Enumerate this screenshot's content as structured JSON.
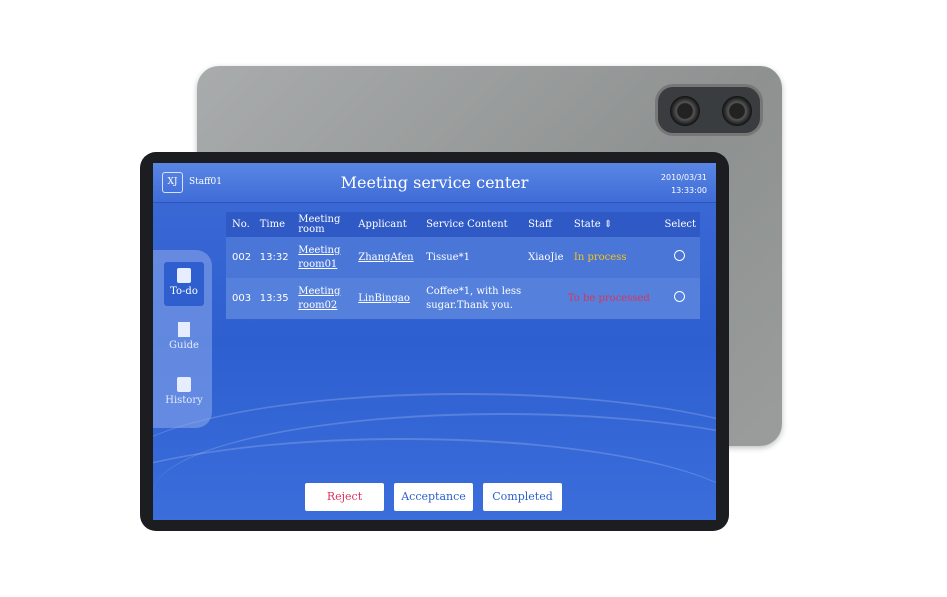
{
  "header": {
    "logo": "XJ",
    "user": "Staff01",
    "title": "Meeting service center",
    "date": "2010/03/31",
    "time": "13:33:00"
  },
  "sidebar": {
    "items": [
      {
        "label": "To-do",
        "icon": "clipboard-icon",
        "active": true
      },
      {
        "label": "Guide",
        "icon": "signpost-icon"
      },
      {
        "label": "History",
        "icon": "calendar-clock-icon"
      }
    ]
  },
  "table": {
    "headers": [
      "No.",
      "Time",
      "Meeting room",
      "Applicant",
      "Service Content",
      "Staff",
      "State",
      "Select"
    ],
    "rows": [
      {
        "no": "002",
        "time": "13:32",
        "room": "Meeting room01",
        "applicant": "ZhangAfen",
        "content": "Tissue*1",
        "staff": "XiaoJie",
        "state": "In process",
        "state_color": "#f5c518"
      },
      {
        "no": "003",
        "time": "13:35",
        "room": "Meeting room02",
        "applicant": "LinBingao",
        "content": "Coffee*1, with less sugar.Thank you.",
        "staff": "",
        "state": "To be processed",
        "state_color": "#d8345a"
      }
    ]
  },
  "buttons": {
    "reject": "Reject",
    "acceptance": "Acceptance",
    "completed": "Completed"
  }
}
